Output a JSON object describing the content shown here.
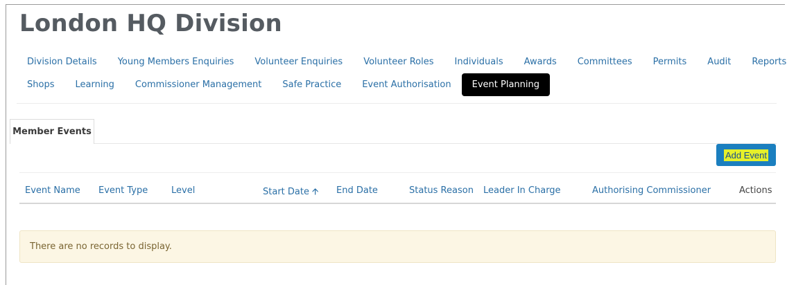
{
  "header": {
    "title": "London HQ Division"
  },
  "nav": {
    "row1": [
      "Division Details",
      "Young Members Enquiries",
      "Volunteer Enquiries",
      "Volunteer Roles",
      "Individuals",
      "Awards",
      "Committees",
      "Permits",
      "Audit",
      "Reports"
    ],
    "row2": [
      "Shops",
      "Learning",
      "Commissioner Management",
      "Safe Practice",
      "Event Authorisation",
      "Event Planning"
    ],
    "active": "Event Planning"
  },
  "tabs": {
    "member_events": "Member Events"
  },
  "toolbar": {
    "add_event": "Add Event"
  },
  "table": {
    "columns": [
      "Event Name",
      "Event Type",
      "Level",
      "Start Date",
      "End Date",
      "Status Reason",
      "Leader In Charge",
      "Authorising Commissioner",
      "Actions"
    ],
    "sorted_column": "Start Date",
    "sort_direction": "ascending",
    "empty_message": "There are no records to display."
  },
  "colors": {
    "link": "#2a6fa6",
    "active_tab_bg": "#000000",
    "button_bg": "#1b7fbf",
    "button_highlight": "#e6f02a",
    "empty_bg": "#fcf6e4"
  }
}
